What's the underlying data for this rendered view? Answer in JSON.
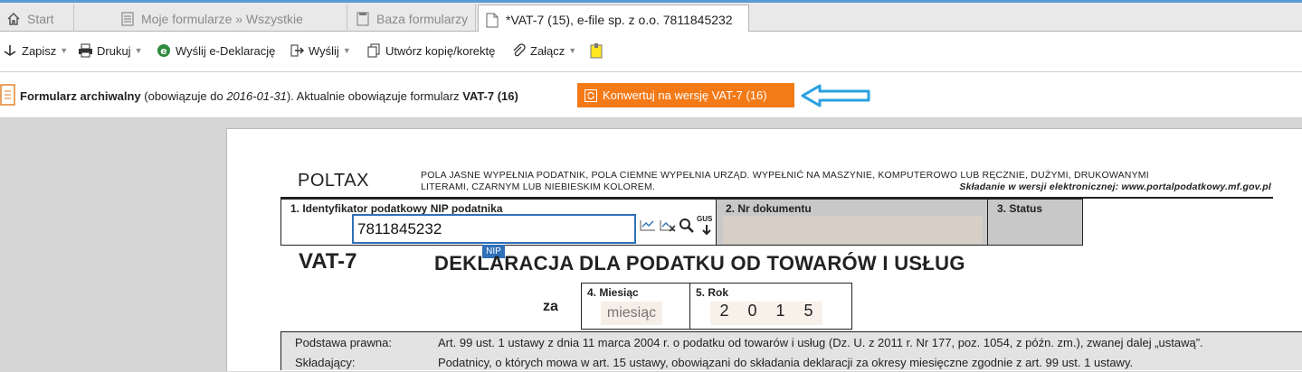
{
  "tabs": [
    {
      "label": "Start",
      "icon": "home-icon"
    },
    {
      "label": "Moje formularze » Wszystkie",
      "icon": "list-icon"
    },
    {
      "label": "Baza formularzy",
      "icon": "document-list-icon"
    },
    {
      "label": "*VAT-7 (15), e-file sp. z o.o. 7811845232",
      "icon": "document-icon"
    }
  ],
  "toolbar": {
    "save": "Zapisz",
    "print": "Drukuj",
    "send_edeclaration": "Wyślij e-Deklarację",
    "send": "Wyślij",
    "copy": "Utwórz kopię/korektę",
    "attach": "Załącz"
  },
  "notice": {
    "bold1": "Formularz archiwalny",
    "text1": " (obowiązuje do ",
    "date": "2016-01-31",
    "text2": "). Aktualnie obowiązuje formularz ",
    "bold2": "VAT-7 (16)",
    "convert_button": "Konwertuj na wersję VAT-7 (16)"
  },
  "form": {
    "poltax": "POLTAX",
    "note_line1": "POLA JASNE WYPEŁNIA PODATNIK, POLA CIEMNE WYPEŁNIA URZĄD. WYPEŁNIĆ NA MASZYNIE, KOMPUTEROWO LUB RĘCZNIE, DUŻYMI, DRUKOWANYMI",
    "note_line2a": "LITERAMI, CZARNYM LUB NIEBIESKIM KOLOREM.",
    "note_line2b": "Składanie w wersji elektronicznej: www.portalpodatkowy.mf.gov.pl",
    "field1_label": "1. Identyfikator podatkowy NIP podatnika",
    "nip_value": "7811845232",
    "nip_tag": "NIP",
    "field2_label": "2. Nr dokumentu",
    "field3_label": "3. Status",
    "form_code": "VAT-7",
    "form_title": "DEKLARACJA DLA PODATKU OD TOWARÓW I USŁUG",
    "za": "za",
    "field4_label": "4. Miesiąc",
    "month_placeholder": "miesiąc",
    "field5_label": "5. Rok",
    "year_digits": [
      "2",
      "0",
      "1",
      "5"
    ],
    "gus": "GUS",
    "legal_rows": [
      {
        "k": "Podstawa prawna:",
        "v": "Art. 99 ust. 1 ustawy z dnia 11 marca 2004 r. o podatku od towarów i usług (Dz. U. z 2011 r. Nr 177, poz. 1054, z późn. zm.),  zwanej dalej „ustawą”."
      },
      {
        "k": "Składający:",
        "v": "Podatnicy, o których mowa  w art. 15 ustawy, obowiązani do składania deklaracji za okresy miesięczne zgodnie z art. 99 ust. 1 ustawy."
      }
    ]
  },
  "colors": {
    "accent": "#f47a18",
    "focus": "#2f70b8",
    "arrow": "#2aa0e0"
  }
}
